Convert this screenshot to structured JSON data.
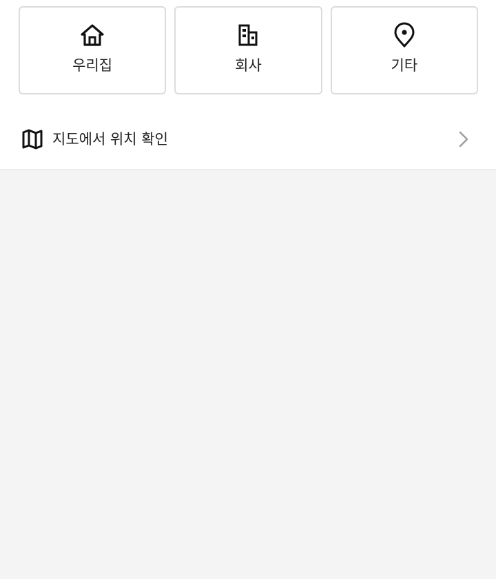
{
  "address_types": [
    {
      "label": "우리집",
      "icon": "home-icon"
    },
    {
      "label": "회사",
      "icon": "building-icon"
    },
    {
      "label": "기타",
      "icon": "location-pin-icon"
    }
  ],
  "map_link": {
    "label": "지도에서 위치 확인",
    "icon": "map-icon",
    "trailing_icon": "chevron-right-icon"
  },
  "colors": {
    "card_border": "#dcdcdc",
    "page_background": "#f4f4f4",
    "surface": "#ffffff",
    "chevron": "#9e9e9e"
  }
}
